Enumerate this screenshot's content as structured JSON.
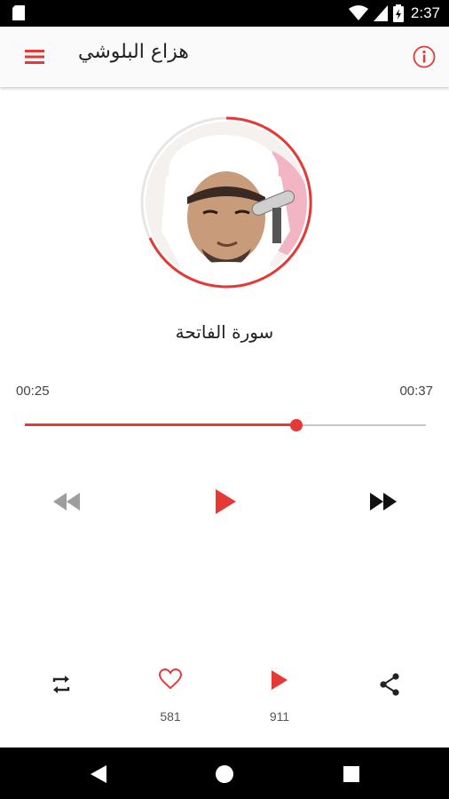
{
  "status_bar": {
    "time": "2:37",
    "icons": [
      "sim-card-icon",
      "wifi-icon",
      "cell-signal-icon",
      "battery-icon"
    ]
  },
  "app_bar": {
    "title": "هزاع البلوشي",
    "menu_icon": "hamburger-menu-icon",
    "info_icon": "info-icon"
  },
  "player": {
    "track_title": "سورة الفاتحة",
    "time_elapsed": "00:25",
    "time_total": "00:37",
    "progress": 0.676,
    "controls": [
      "rewind-icon",
      "play-icon",
      "fast-forward-icon"
    ]
  },
  "actions": {
    "likes": "581",
    "plays": "911",
    "icons": [
      "repeat-icon",
      "heart-icon",
      "play-icon",
      "share-icon"
    ]
  },
  "colors": {
    "accent": "#e53935",
    "disabled": "#9e9e9e",
    "text": "#222222"
  },
  "nav_bar": {
    "icons": [
      "back-icon",
      "home-icon",
      "recents-icon"
    ]
  }
}
